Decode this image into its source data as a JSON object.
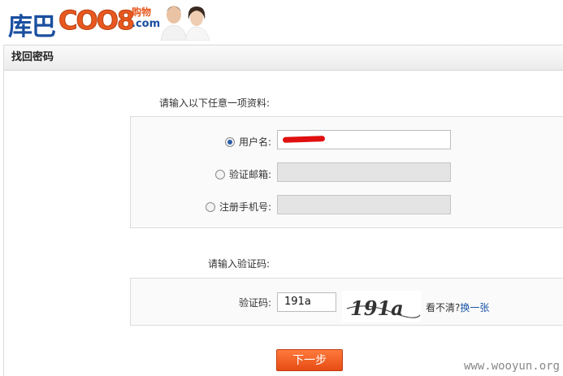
{
  "brand": {
    "name_cn": "库巴",
    "name_en": "COO8",
    "tagline": "购物",
    "domain": ".com"
  },
  "panel": {
    "title": "找回密码"
  },
  "form": {
    "instruction": "请输入以下任意一项资料:",
    "options": [
      {
        "label": "用户名:",
        "checked": true,
        "value": "",
        "disabled": false
      },
      {
        "label": "验证邮箱:",
        "checked": false,
        "value": "",
        "disabled": true
      },
      {
        "label": "注册手机号:",
        "checked": false,
        "value": "",
        "disabled": true
      }
    ],
    "captcha_prompt": "请输入验证码:",
    "captcha_label": "验证码:",
    "captcha_value": "191a",
    "captcha_image_text": "191a",
    "unclear_text": "看不清?",
    "refresh_link": "换一张",
    "next_button": "下一步"
  },
  "watermark": "www.wooyun.org",
  "colors": {
    "accent": "#e8581f",
    "brand_blue": "#1a4fa0",
    "link": "#1a55a8"
  }
}
